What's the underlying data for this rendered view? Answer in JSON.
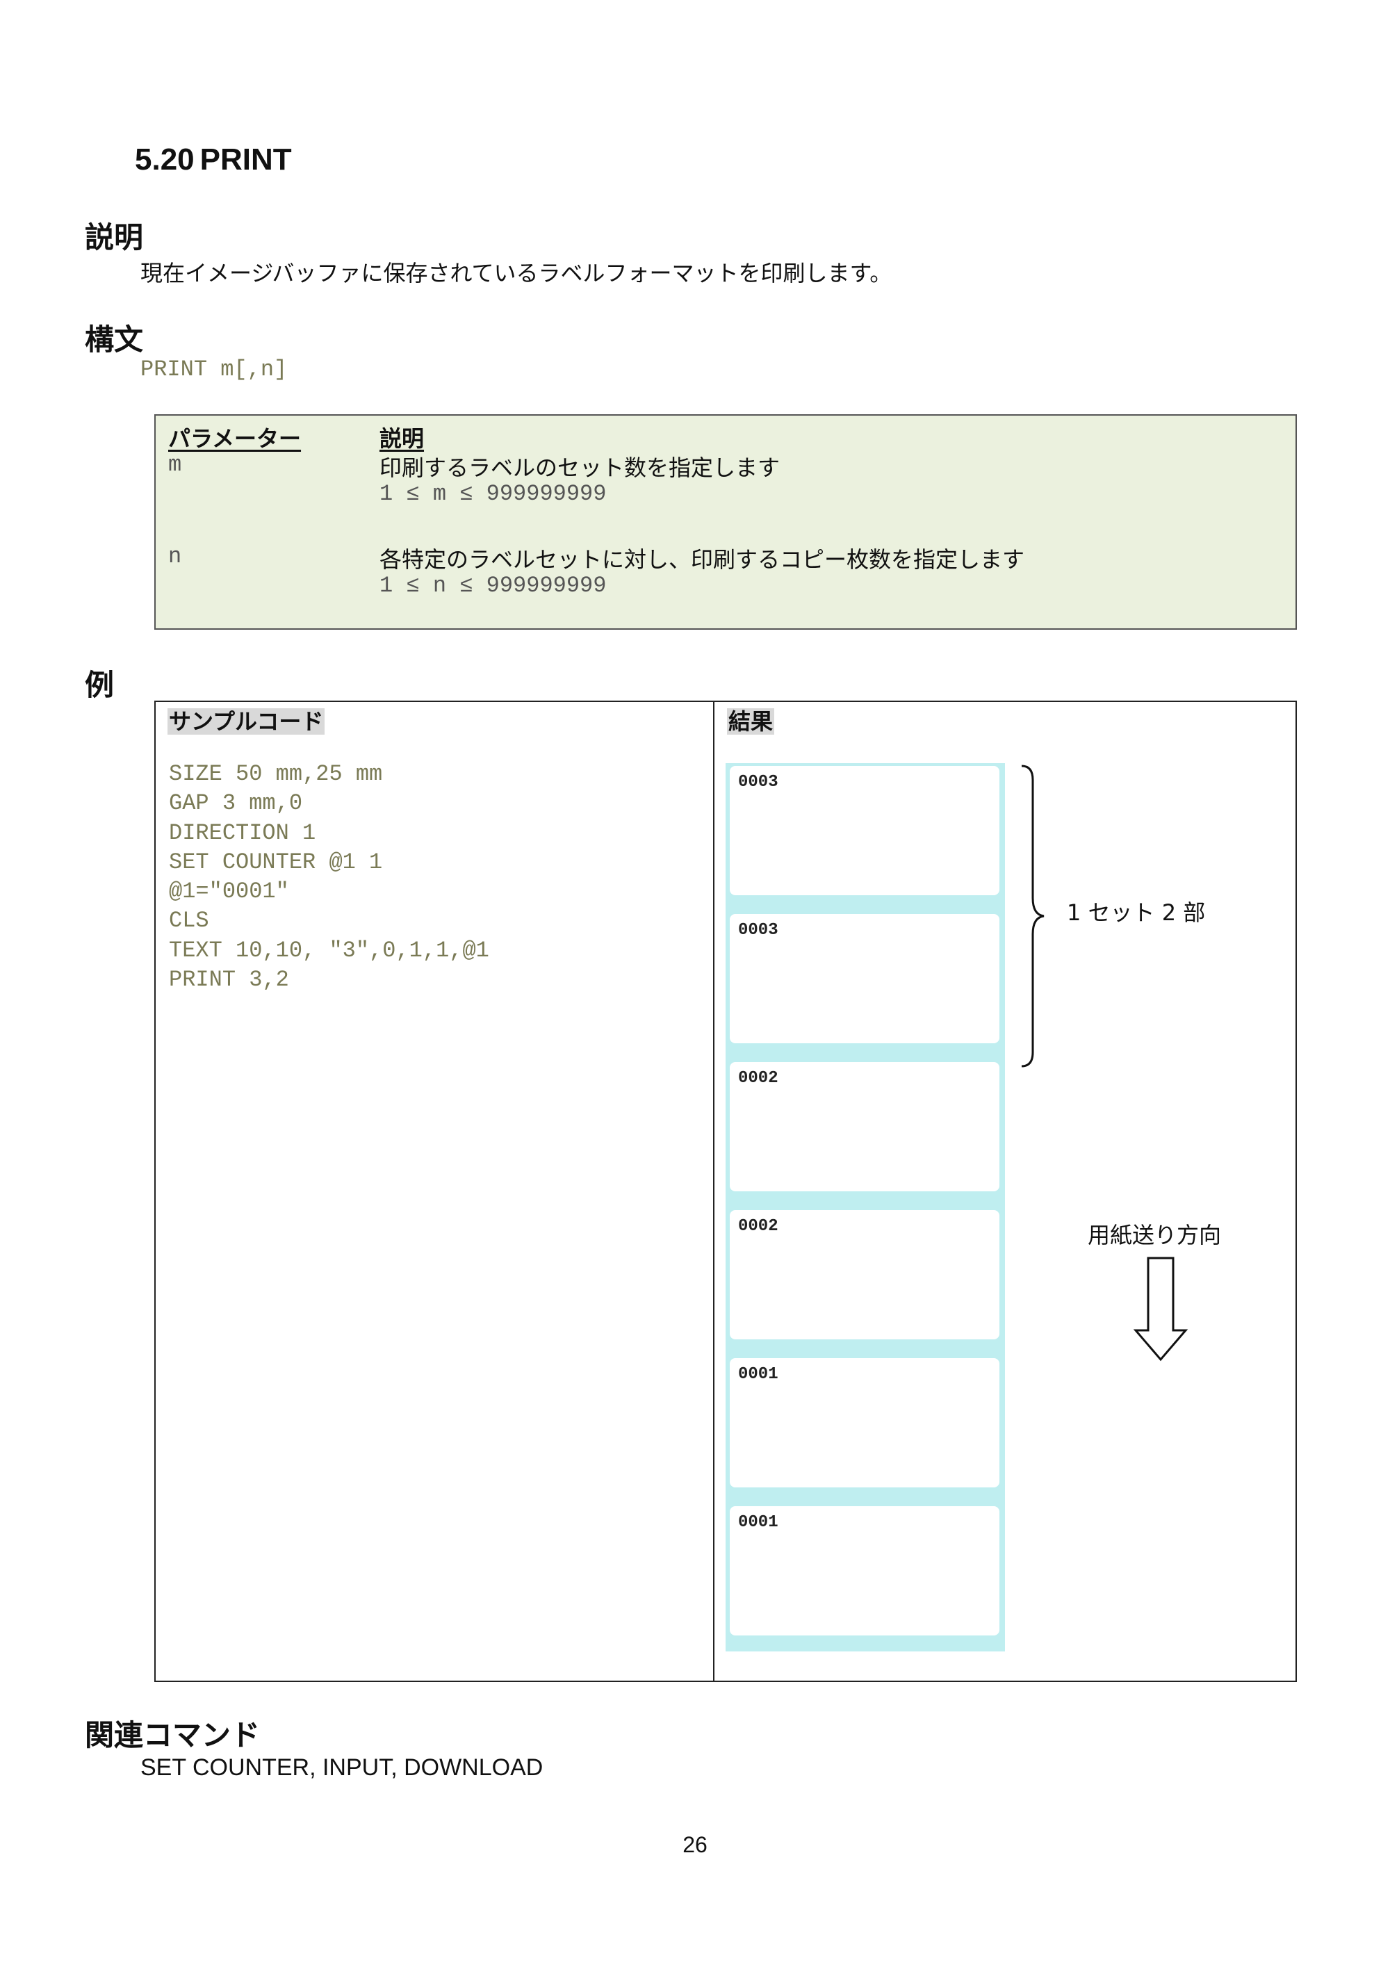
{
  "section": {
    "number": "5.20",
    "title": "PRINT"
  },
  "description": {
    "heading": "説明",
    "text": "現在イメージバッファに保存されているラベルフォーマットを印刷します。"
  },
  "syntax": {
    "heading": "構文",
    "code": "PRINT m[,n]"
  },
  "param_table": {
    "header_param": "パラメーター",
    "header_desc": "説明",
    "rows": [
      {
        "name": "m",
        "desc": "印刷するラベルのセット数を指定します",
        "range": "1 ≤ m ≤ 999999999"
      },
      {
        "name": "n",
        "desc": "各特定のラベルセットに対し、印刷するコピー枚数を指定します",
        "range": "1 ≤ n ≤ 999999999"
      }
    ]
  },
  "example": {
    "heading": "例",
    "col_code": "サンプルコード",
    "col_result": "結果",
    "code_lines": [
      "SIZE 50 mm,25 mm",
      "GAP 3 mm,0",
      "DIRECTION 1",
      "SET COUNTER @1 1",
      "@1=\"0001\"",
      "CLS",
      "TEXT 10,10, \"3\",0,1,1,@1",
      "PRINT 3,2"
    ],
    "labels": [
      "0003",
      "0003",
      "0002",
      "0002",
      "0001",
      "0001"
    ],
    "set_annotation": "1 セット 2 部",
    "feed_annotation": "用紙送り方向"
  },
  "related": {
    "heading": "関連コマンド",
    "text": "SET COUNTER, INPUT, DOWNLOAD"
  },
  "page_number": "26",
  "colors": {
    "code": "#7a7a55",
    "table_bg": "#ebf1de",
    "label_backing": "#bfeef0"
  }
}
